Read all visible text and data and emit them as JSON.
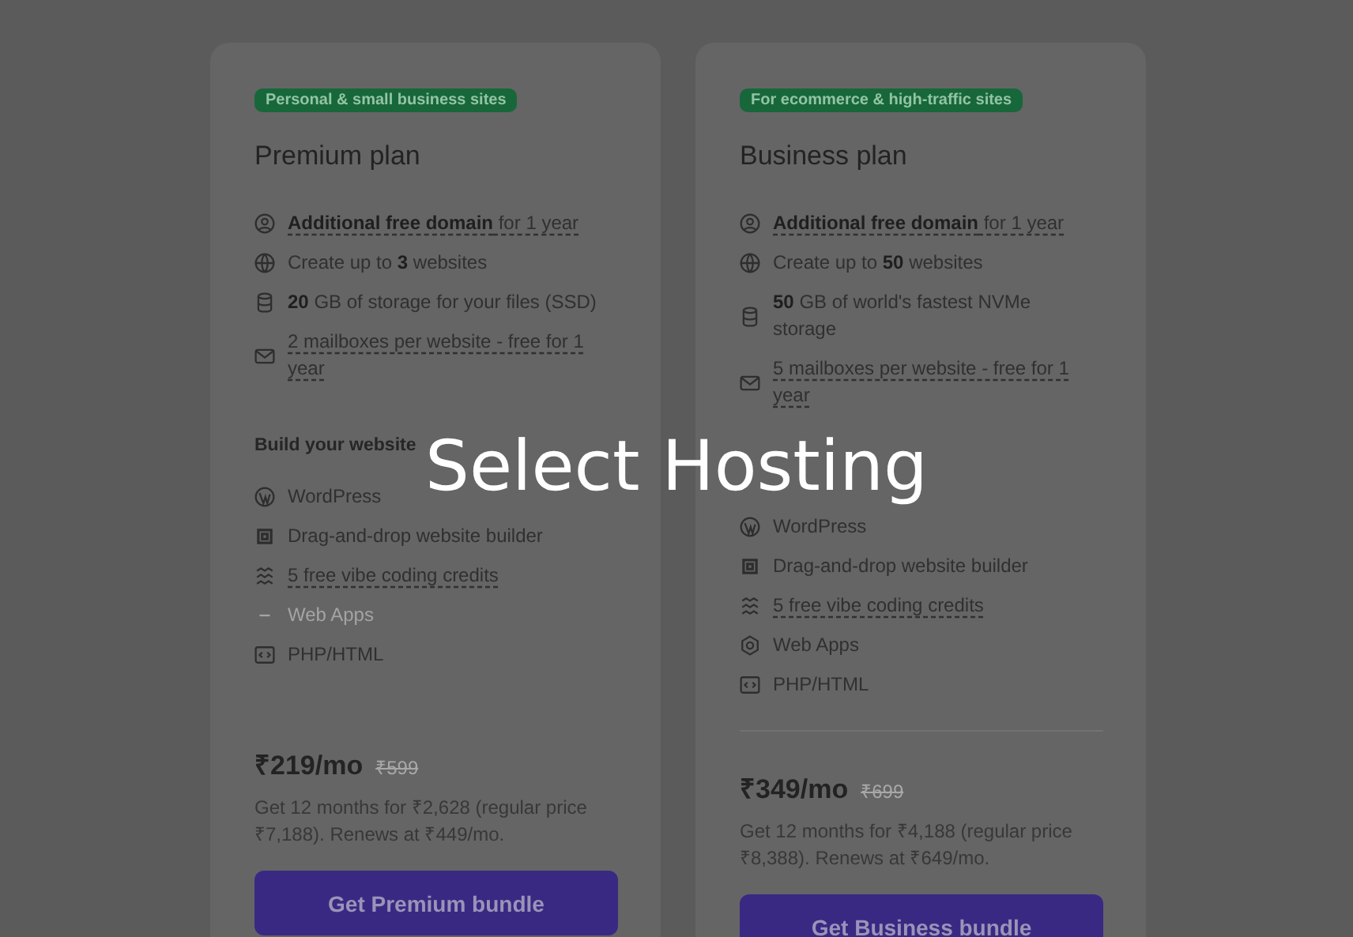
{
  "overlay_title": "Select Hosting",
  "plans": [
    {
      "badge": "Personal & small business sites",
      "name": "Premium plan",
      "features": [
        {
          "kind": "user",
          "text": "**Additional free domain** for 1 year",
          "dashed": true,
          "disabled": false
        },
        {
          "kind": "globe",
          "text": "Create up to **3** websites",
          "dashed": false,
          "disabled": false
        },
        {
          "kind": "database",
          "text": "**20** GB of storage for your files (SSD)",
          "dashed": false,
          "disabled": false
        },
        {
          "kind": "mail",
          "text": "2 mailboxes per website - free for 1 year",
          "dashed": true,
          "disabled": false
        }
      ],
      "build_heading": "Build your website",
      "build_items": [
        {
          "kind": "wordpress",
          "text": "WordPress",
          "dashed": false,
          "disabled": false
        },
        {
          "kind": "builder",
          "text": "Drag-and-drop website builder",
          "dashed": false,
          "disabled": false
        },
        {
          "kind": "waves",
          "text": "5 free vibe coding credits",
          "dashed": true,
          "disabled": false
        },
        {
          "kind": "dash",
          "text": "Web Apps",
          "dashed": false,
          "disabled": true
        },
        {
          "kind": "code",
          "text": "PHP/HTML",
          "dashed": false,
          "disabled": false
        }
      ],
      "divider": false,
      "price": "₹219/mo",
      "old_price": "₹599",
      "terms": "Get 12 months for ₹2,628 (regular price ₹7,188). Renews at ₹449/mo.",
      "button": "Get Premium bundle"
    },
    {
      "badge": "For ecommerce & high-traffic sites",
      "name": "Business plan",
      "features": [
        {
          "kind": "user",
          "text": "**Additional free domain** for 1 year",
          "dashed": true,
          "disabled": false
        },
        {
          "kind": "globe",
          "text": "Create up to **50** websites",
          "dashed": false,
          "disabled": false
        },
        {
          "kind": "database",
          "text": "**50** GB of world's fastest NVMe storage",
          "dashed": false,
          "disabled": false
        },
        {
          "kind": "mail",
          "text": "5 mailboxes per website - free for 1 year",
          "dashed": true,
          "disabled": false
        }
      ],
      "build_items": [
        {
          "kind": "wordpress",
          "text": "WordPress",
          "dashed": false,
          "disabled": false
        },
        {
          "kind": "builder",
          "text": "Drag-and-drop website builder",
          "dashed": false,
          "disabled": false
        },
        {
          "kind": "waves",
          "text": "5 free vibe coding credits",
          "dashed": true,
          "disabled": false
        },
        {
          "kind": "hexagon",
          "text": "Web Apps",
          "dashed": false,
          "disabled": false
        },
        {
          "kind": "code",
          "text": "PHP/HTML",
          "dashed": false,
          "disabled": false
        }
      ],
      "divider": true,
      "price": "₹349/mo",
      "old_price": "₹699",
      "terms": "Get 12 months for ₹4,188 (regular price ₹8,388). Renews at ₹649/mo.",
      "button": "Get Business bundle"
    }
  ]
}
